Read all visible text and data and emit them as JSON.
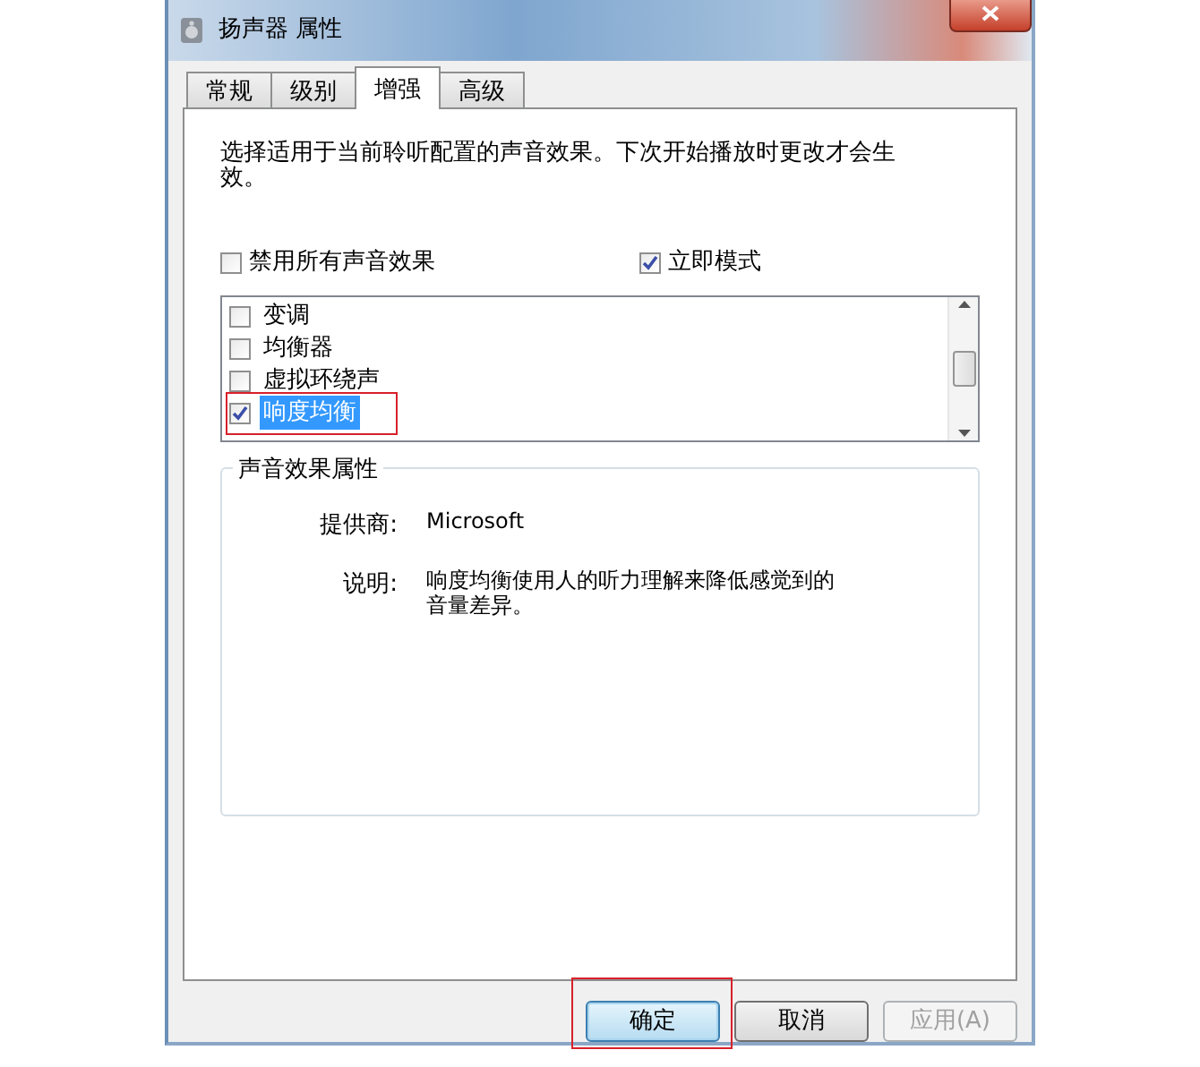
{
  "window": {
    "title": "扬声器 属性"
  },
  "tabs": [
    {
      "label": "常规",
      "selected": false
    },
    {
      "label": "级别",
      "selected": false
    },
    {
      "label": "增强",
      "selected": true
    },
    {
      "label": "高级",
      "selected": false
    }
  ],
  "intro": "选择适用于当前聆听配置的声音效果。下次开始播放时更改才会生效。",
  "disable_all": {
    "label": "禁用所有声音效果",
    "checked": false
  },
  "immediate_mode": {
    "label": "立即模式",
    "checked": true
  },
  "effects": [
    {
      "label": "变调",
      "checked": false,
      "selected": false,
      "highlighted": false
    },
    {
      "label": "均衡器",
      "checked": false,
      "selected": false,
      "highlighted": false
    },
    {
      "label": "虚拟环绕声",
      "checked": false,
      "selected": false,
      "highlighted": false
    },
    {
      "label": "响度均衡",
      "checked": true,
      "selected": true,
      "highlighted": true
    }
  ],
  "properties": {
    "title": "声音效果属性",
    "rows": [
      {
        "label": "提供商:",
        "value": "Microsoft"
      },
      {
        "label": "说明:",
        "value": "响度均衡使用人的听力理解来降低感觉到的音量差异。"
      }
    ]
  },
  "buttons": [
    {
      "label": "确定",
      "default": true,
      "disabled": false,
      "highlighted": true
    },
    {
      "label": "取消",
      "default": false,
      "disabled": false,
      "highlighted": false
    },
    {
      "label": "应用(A)",
      "default": false,
      "disabled": true,
      "highlighted": false
    }
  ]
}
